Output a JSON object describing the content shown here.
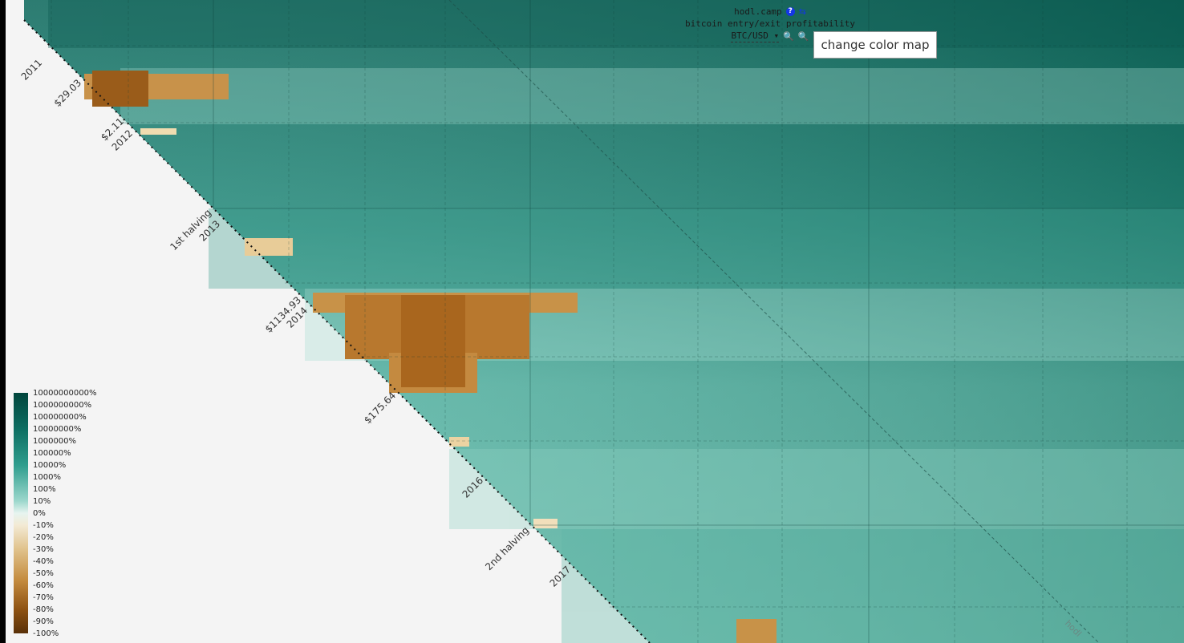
{
  "header": {
    "site": "hodl.camp",
    "subtitle": "bitcoin entry/exit profitability",
    "pair": "BTC/USD",
    "icons": [
      "help-icon",
      "share-icon",
      "zoom-out-icon",
      "zoom-in-icon",
      "dropdown-caret-icon"
    ]
  },
  "tooltip": {
    "text": "change color map"
  },
  "diagonal_labels": [
    {
      "text": "2011"
    },
    {
      "text": "$29.03"
    },
    {
      "text": "$2.11"
    },
    {
      "text": "2012"
    },
    {
      "text": "1st halving"
    },
    {
      "text": "2013"
    },
    {
      "text": "$1134.93"
    },
    {
      "text": "2014"
    },
    {
      "text": "$175.64"
    },
    {
      "text": "2016"
    },
    {
      "text": "2nd halving"
    },
    {
      "text": "2017"
    }
  ],
  "hodl_line_label": "hodl",
  "legend": {
    "labels": [
      "10000000000%",
      "1000000000%",
      "100000000%",
      "10000000%",
      "1000000%",
      "100000%",
      "10000%",
      "1000%",
      "100%",
      "10%",
      "0%",
      "-10%",
      "-20%",
      "-30%",
      "-40%",
      "-50%",
      "-60%",
      "-70%",
      "-80%",
      "-90%",
      "-100%"
    ],
    "colors": {
      "max_gain": "#01453c",
      "mid_gain": "#2e9d8d",
      "zero": "#f5f5f0",
      "mid_loss": "#d9aa5c",
      "max_loss": "#593008"
    }
  },
  "colors": {
    "background": "#f4f4f4",
    "link_blue": "#1336e6"
  }
}
